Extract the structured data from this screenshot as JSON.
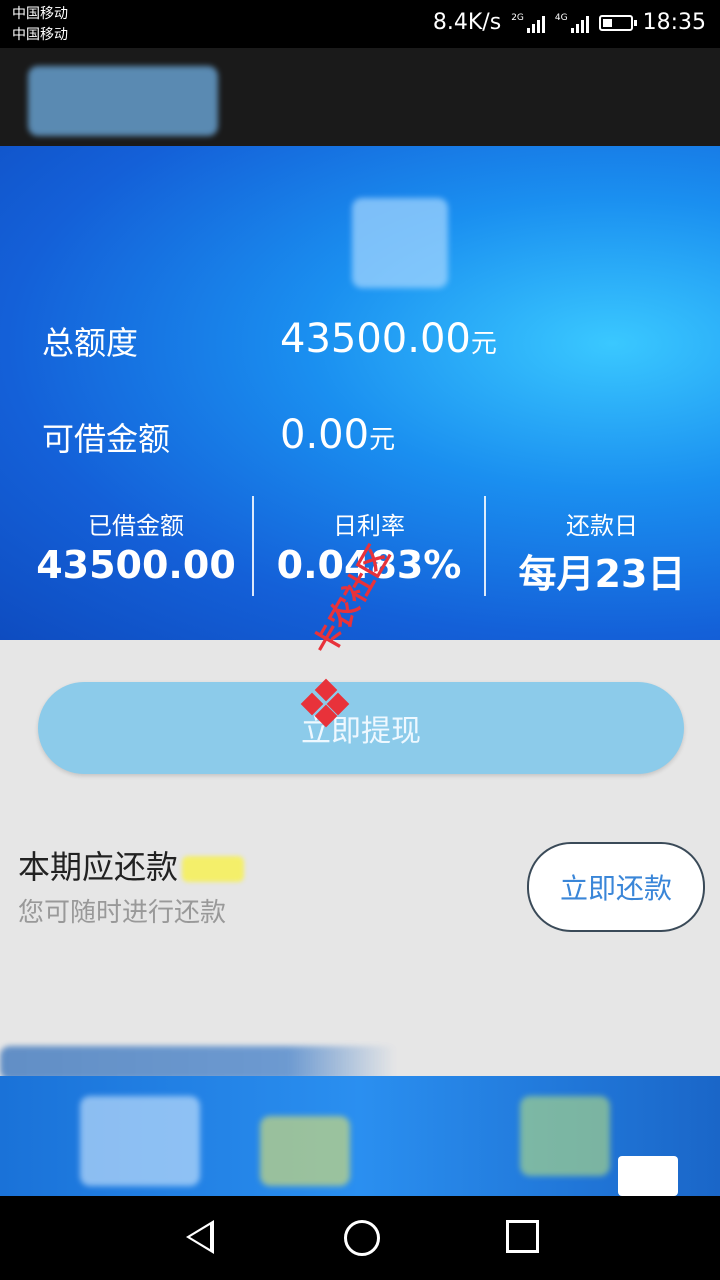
{
  "status_bar": {
    "carrier_1": "中国移动",
    "carrier_2": "中国移动",
    "network_speed": "8.4K/s",
    "sim1_network": "2G",
    "sim2_network": "4G",
    "battery_level": 0.35,
    "time": "18:35"
  },
  "credit": {
    "total_label": "总额度",
    "total_value": "43500.00",
    "total_unit": "元",
    "available_label": "可借金额",
    "available_value": "0.00",
    "available_unit": "元",
    "stats": [
      {
        "label": "已借金额",
        "value": "43500.00"
      },
      {
        "label": "日利率",
        "value": "0.0483%"
      },
      {
        "label": "还款日",
        "value": "每月23日"
      }
    ]
  },
  "watermark": "卡农社区",
  "withdraw_button": "立即提现",
  "repayment": {
    "title": "本期应还款",
    "subtitle": "您可随时进行还款",
    "button": "立即还款"
  },
  "colors": {
    "hero_blue": "#1a8ff0",
    "withdraw_button": "#8ccbea",
    "watermark_red": "#e8323a",
    "repay_button_text": "#3a86d8"
  },
  "nav_icons": [
    "back-icon",
    "home-icon",
    "recent-apps-icon"
  ]
}
